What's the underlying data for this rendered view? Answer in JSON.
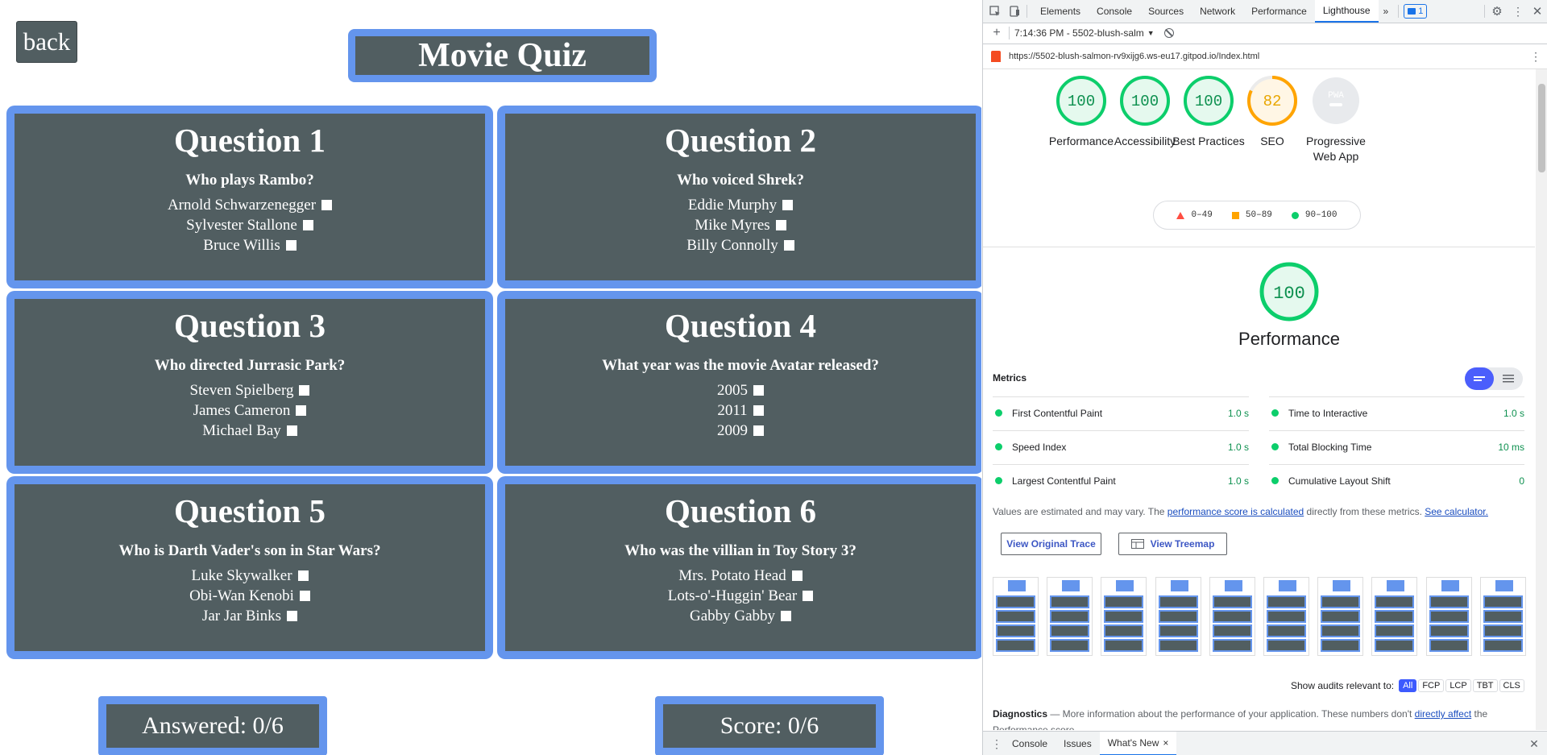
{
  "quiz": {
    "back_label": "back",
    "title": "Movie Quiz",
    "questions": [
      {
        "title": "Question 1",
        "text": "Who plays Rambo?",
        "options": [
          "Arnold Schwarzenegger",
          "Sylvester Stallone",
          "Bruce Willis"
        ]
      },
      {
        "title": "Question 2",
        "text": "Who voiced Shrek?",
        "options": [
          "Eddie Murphy",
          "Mike Myres",
          "Billy Connolly"
        ]
      },
      {
        "title": "Question 3",
        "text": "Who directed Jurrasic Park?",
        "options": [
          "Steven Spielberg",
          "James Cameron",
          "Michael Bay"
        ]
      },
      {
        "title": "Question 4",
        "text": "What year was the movie Avatar released?",
        "options": [
          "2005",
          "2011",
          "2009"
        ]
      },
      {
        "title": "Question 5",
        "text": "Who is Darth Vader's son in Star Wars?",
        "options": [
          "Luke Skywalker",
          "Obi-Wan Kenobi",
          "Jar Jar Binks"
        ]
      },
      {
        "title": "Question 6",
        "text": "Who was the villian in Toy Story 3?",
        "options": [
          "Mrs. Potato Head",
          "Lots-o'-Huggin' Bear",
          "Gabby Gabby"
        ]
      }
    ],
    "answered": "Answered: 0/6",
    "score": "Score: 0/6"
  },
  "devtools": {
    "tabs": [
      "Elements",
      "Console",
      "Sources",
      "Network",
      "Performance",
      "Lighthouse"
    ],
    "active_tab": "Lighthouse",
    "more_tabs": "»",
    "issues_count": "1",
    "toolbar_report": "7:14:36 PM - 5502-blush-salm",
    "url": "https://5502-blush-salmon-rv9xijg6.ws-eu17.gitpod.io/Index.html",
    "gauges": [
      {
        "label": "Performance",
        "score": "100",
        "value": 100,
        "color": "#0cce6b"
      },
      {
        "label": "Accessibility",
        "score": "100",
        "value": 100,
        "color": "#0cce6b"
      },
      {
        "label": "Best Practices",
        "score": "100",
        "value": 100,
        "color": "#0cce6b"
      },
      {
        "label": "SEO",
        "score": "82",
        "value": 82,
        "color": "#ffa400"
      },
      {
        "label": "Progressive Web App",
        "score": "PWA",
        "value": 0,
        "color": "#bdc1c6"
      }
    ],
    "legend": [
      {
        "range": "0–49",
        "color": "#ff4e42"
      },
      {
        "range": "50–89",
        "color": "#ffa400"
      },
      {
        "range": "90–100",
        "color": "#0cce6b"
      }
    ],
    "perf_score": "100",
    "perf_label": "Performance",
    "metrics_heading": "Metrics",
    "metrics": [
      {
        "name": "First Contentful Paint",
        "value": "1.0 s"
      },
      {
        "name": "Time to Interactive",
        "value": "1.0 s"
      },
      {
        "name": "Speed Index",
        "value": "1.0 s"
      },
      {
        "name": "Total Blocking Time",
        "value": "10 ms"
      },
      {
        "name": "Largest Contentful Paint",
        "value": "1.0 s"
      },
      {
        "name": "Cumulative Layout Shift",
        "value": "0"
      }
    ],
    "note_text_1": "Values are estimated and may vary. The ",
    "note_link_1": "performance score is calculated",
    "note_text_2": " directly from these metrics. ",
    "note_link_2": "See calculator.",
    "btn_trace": "View Original Trace",
    "btn_treemap": "View Treemap",
    "audits_label": "Show audits relevant to:",
    "audit_chips": [
      "All",
      "FCP",
      "LCP",
      "TBT",
      "CLS"
    ],
    "diag_title": "Diagnostics",
    "diag_text_1": " — More information about the performance of your application. These numbers don't ",
    "diag_link": "directly affect",
    "diag_text_2": " the Performance score.",
    "drawer_tabs": [
      "Console",
      "Issues",
      "What's New"
    ],
    "drawer_close": "×"
  }
}
